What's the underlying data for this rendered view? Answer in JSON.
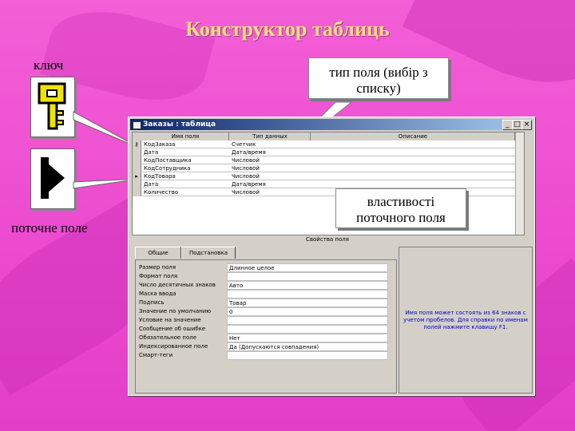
{
  "slide": {
    "title": "Конструктор таблиць",
    "key_caption": "ключ",
    "current_field_caption": "поточне поле",
    "callout_type": "тип поля (вибір з списку)",
    "callout_props": "властивості поточного поля"
  },
  "colors": {
    "background": "#ec49cf",
    "title": "#f2e27a",
    "window_title": "#0a246a",
    "hint_text": "#0000cc"
  },
  "window": {
    "title": "Заказы : таблица",
    "columns": [
      "Имя поля",
      "Тип данных",
      "Описание"
    ],
    "rows": [
      {
        "name": "КодЗаказа",
        "type": "Счетчик",
        "marker": "key"
      },
      {
        "name": "Дата",
        "type": "Дата/время",
        "marker": ""
      },
      {
        "name": "КодПоставщика",
        "type": "Числовой",
        "marker": ""
      },
      {
        "name": "КодСотрудника",
        "type": "Числовой",
        "marker": ""
      },
      {
        "name": "КодТовара",
        "type": "Числовой",
        "marker": "current"
      },
      {
        "name": "Дата",
        "type": "Дата/время",
        "marker": ""
      },
      {
        "name": "Количество",
        "type": "Числовой",
        "marker": ""
      }
    ],
    "properties_label": "Свойства поля",
    "tabs": [
      "Общие",
      "Подстановка"
    ],
    "properties": [
      {
        "label": "Размер поля",
        "value": "Длинное целое"
      },
      {
        "label": "Формат поля",
        "value": ""
      },
      {
        "label": "Число десятичных знаков",
        "value": "Авто"
      },
      {
        "label": "Маска ввода",
        "value": ""
      },
      {
        "label": "Подпись",
        "value": "Товар"
      },
      {
        "label": "Значение по умолчанию",
        "value": "0"
      },
      {
        "label": "Условие на значение",
        "value": ""
      },
      {
        "label": "Сообщение об ошибке",
        "value": ""
      },
      {
        "label": "Обязательное поле",
        "value": "Нет"
      },
      {
        "label": "Индексированное поле",
        "value": "Да (Допускаются совпадения)"
      },
      {
        "label": "Смарт-теги",
        "value": ""
      }
    ],
    "hint": "Имя поля может состоять из 64 знаков с учетом пробелов. Для справки по именам полей нажмите клавишу F1."
  }
}
